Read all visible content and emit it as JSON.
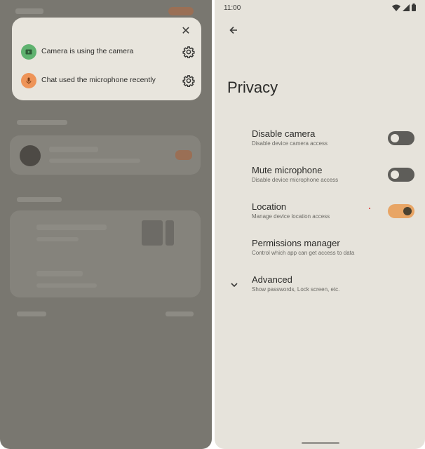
{
  "popup": {
    "items": [
      {
        "text": "Camera is using the camera",
        "icon": "camera-icon",
        "color": "#5fb26f"
      },
      {
        "text": "Chat used the microphone recently",
        "icon": "microphone-icon",
        "color": "#ee9458"
      }
    ]
  },
  "status_bar": {
    "time": "11:00"
  },
  "privacy": {
    "title": "Privacy",
    "settings": [
      {
        "title": "Disable camera",
        "subtitle": "Disable device camera access",
        "toggle": "off"
      },
      {
        "title": "Mute microphone",
        "subtitle": "Disable device microphone access",
        "toggle": "off"
      },
      {
        "title": "Location",
        "subtitle": "Manage device location access",
        "toggle": "on"
      },
      {
        "title": "Permissions manager",
        "subtitle": "Control which app can get access to data"
      },
      {
        "title": "Advanced",
        "subtitle": "Show passwords, Lock screen, etc."
      }
    ],
    "accent_color": "#e8a565"
  }
}
